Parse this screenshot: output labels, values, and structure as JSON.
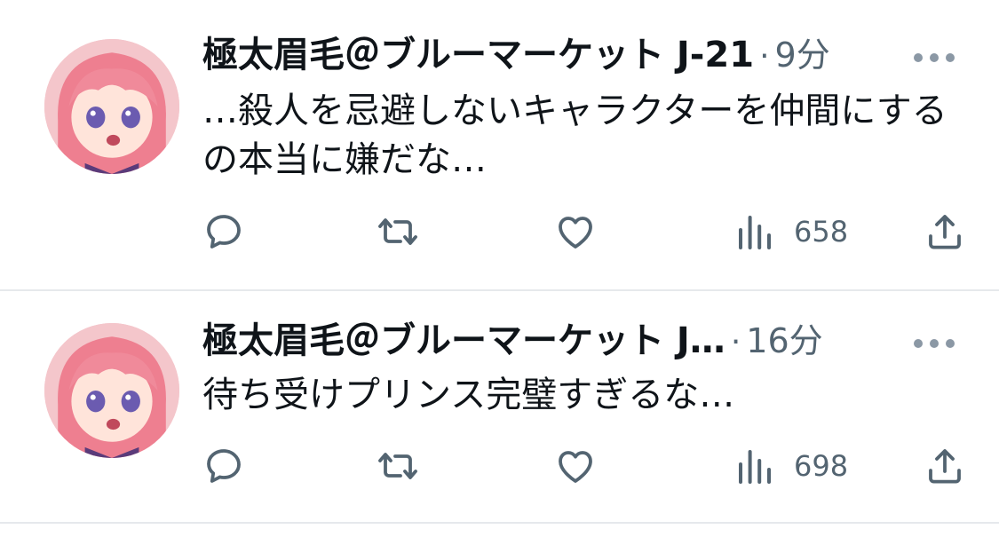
{
  "tweets": [
    {
      "name": "極太眉毛＠ブルーマーケット J-21",
      "dot": "·",
      "time": "9分",
      "text": "…殺人を忌避しないキャラクターを仲間にするの本当に嫌だな…",
      "views": "658"
    },
    {
      "name": "極太眉毛＠ブルーマーケット J…",
      "dot": "·",
      "time": "16分",
      "text": "待ち受けプリンス完璧すぎるな…",
      "views": "698"
    }
  ],
  "colors": {
    "text": "#0f1419",
    "secondary": "#536471",
    "divider": "#e6e9ec"
  },
  "icons": [
    "reply-icon",
    "retweet-icon",
    "like-icon",
    "views-icon",
    "share-icon",
    "more-icon"
  ]
}
